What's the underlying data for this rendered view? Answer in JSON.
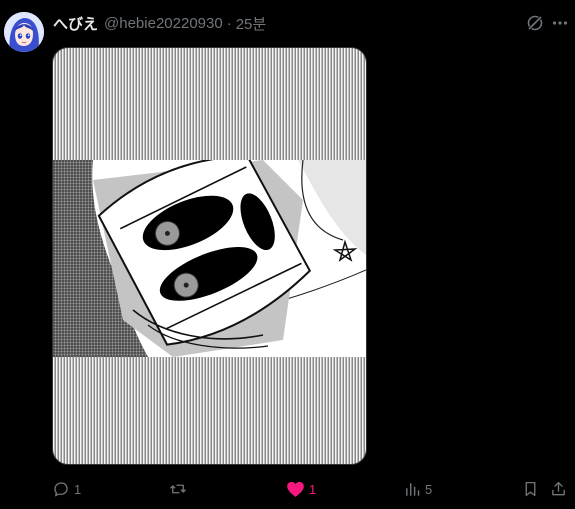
{
  "post": {
    "display_name": "へびえ",
    "handle": "@hebie20220930",
    "separator": "·",
    "time": "25분"
  },
  "icons": {
    "avatar": "avatar",
    "top_right": [
      "grok-icon",
      "more-icon"
    ]
  },
  "media": {
    "alt": "manga panel image"
  },
  "actions": {
    "reply_count": "1",
    "repost_count": "",
    "like_count": "1",
    "views_count": "5"
  },
  "colors": {
    "background": "#000000",
    "text": "#e7e9ea",
    "muted": "#71767b",
    "like": "#f91880"
  }
}
